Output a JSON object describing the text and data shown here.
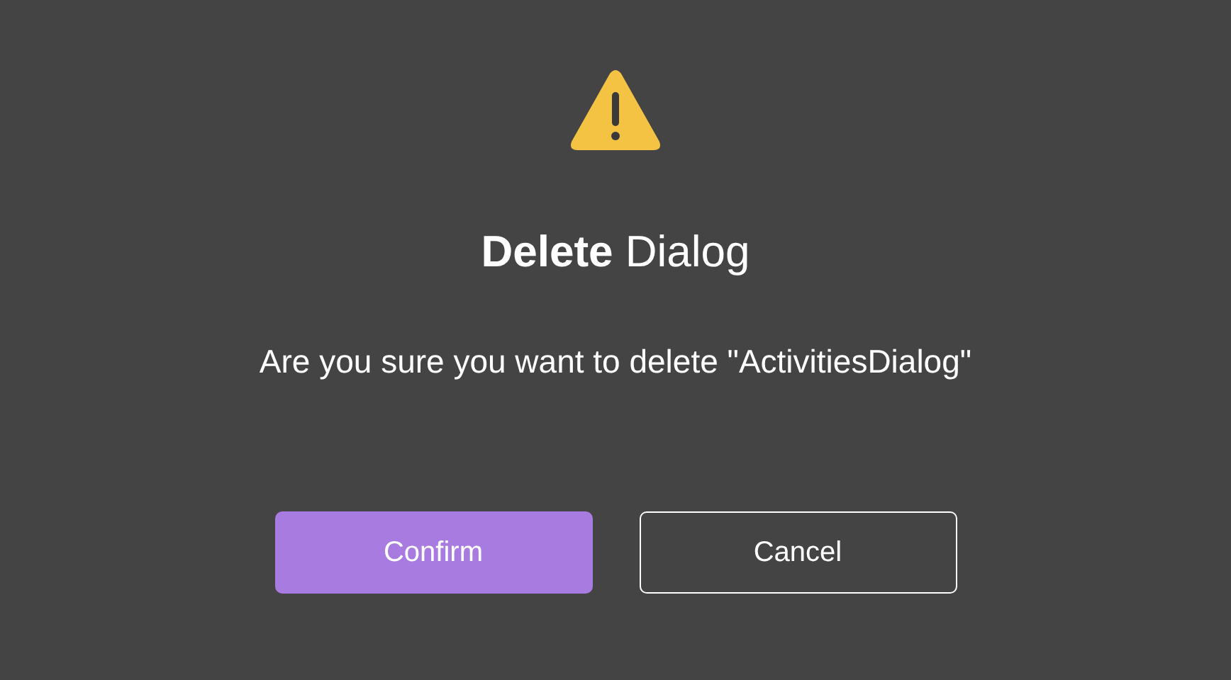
{
  "dialog": {
    "title": "**Delete** Dialog",
    "message": "Are you sure you want to delete \"ActivitiesDialog\"",
    "buttons": [
      {
        "label": "Confirm",
        "kind": "primary"
      },
      {
        "label": "Cancel",
        "kind": "outline"
      }
    ]
  }
}
